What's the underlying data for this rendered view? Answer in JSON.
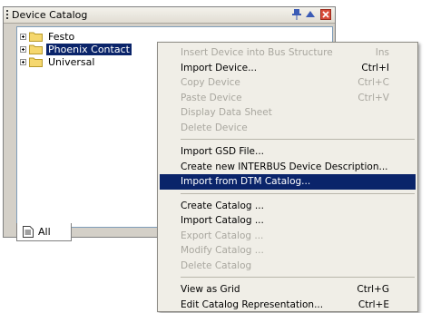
{
  "panel": {
    "title": "Device Catalog",
    "tree_items": [
      {
        "label": "Festo",
        "selected": false
      },
      {
        "label": "Phoenix Contact",
        "selected": true
      },
      {
        "label": "Universal",
        "selected": false
      }
    ],
    "tab_label": "All"
  },
  "menu": {
    "groups": [
      [
        {
          "label": "Insert Device into Bus Structure",
          "shortcut": "Ins",
          "disabled": true
        },
        {
          "label": "Import Device...",
          "shortcut": "Ctrl+I",
          "disabled": false
        },
        {
          "label": "Copy Device",
          "shortcut": "Ctrl+C",
          "disabled": true
        },
        {
          "label": "Paste Device",
          "shortcut": "Ctrl+V",
          "disabled": true
        },
        {
          "label": "Display Data Sheet",
          "shortcut": "",
          "disabled": true
        },
        {
          "label": "Delete Device",
          "shortcut": "",
          "disabled": true
        }
      ],
      [
        {
          "label": "Import GSD File...",
          "shortcut": "",
          "disabled": false
        },
        {
          "label": "Create new INTERBUS Device Description...",
          "shortcut": "",
          "disabled": false
        },
        {
          "label": "Import from DTM Catalog...",
          "shortcut": "",
          "disabled": false,
          "highlighted": true
        }
      ],
      [
        {
          "label": "Create Catalog ...",
          "shortcut": "",
          "disabled": false
        },
        {
          "label": "Import Catalog ...",
          "shortcut": "",
          "disabled": false
        },
        {
          "label": "Export Catalog ...",
          "shortcut": "",
          "disabled": true
        },
        {
          "label": "Modify Catalog ...",
          "shortcut": "",
          "disabled": true
        },
        {
          "label": "Delete Catalog",
          "shortcut": "",
          "disabled": true
        }
      ],
      [
        {
          "label": "View as Grid",
          "shortcut": "Ctrl+G",
          "disabled": false
        },
        {
          "label": "Edit Catalog Representation...",
          "shortcut": "Ctrl+E",
          "disabled": false
        }
      ]
    ]
  },
  "colors": {
    "selection": "#0a246a",
    "disabled_text": "#a9a79f",
    "folder": "#f5d76e"
  },
  "icons": [
    "grip-icon",
    "pin-icon",
    "arrow-up-icon",
    "close-icon",
    "expand-icon",
    "folder-icon",
    "document-icon"
  ]
}
